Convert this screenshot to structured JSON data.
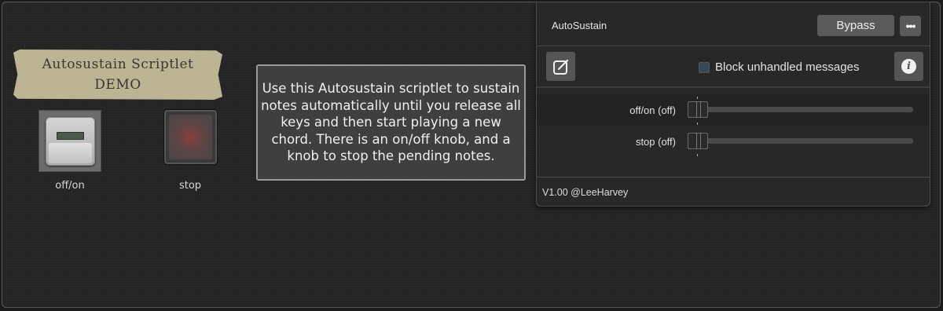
{
  "banner": {
    "line1": "Autosustain Scriptlet",
    "line2": "DEMO"
  },
  "widgets": {
    "switch_label": "off/on",
    "stop_label": "stop"
  },
  "description": "Use this Autosustain scriptlet to sustain notes automatically until you release all keys and then start playing a new chord. There is an on/off knob, and a knob to stop the pending notes.",
  "plugin": {
    "title": "AutoSustain",
    "bypass_label": "Bypass",
    "more_label": "•••",
    "block_label": "Block unhandled messages",
    "block_checked": false,
    "info_label": "i",
    "version": "V1.00 @LeeHarvey",
    "params": [
      {
        "label": "off/on (off)",
        "value": 0
      },
      {
        "label": "stop (off)",
        "value": 0
      }
    ]
  },
  "colors": {
    "background": "#1b1b1b",
    "banner": "#bdb494",
    "stop_glow": "#8a3e3e"
  },
  "icons": {
    "edit": "edit-icon",
    "info": "info-icon",
    "more": "more-icon"
  }
}
